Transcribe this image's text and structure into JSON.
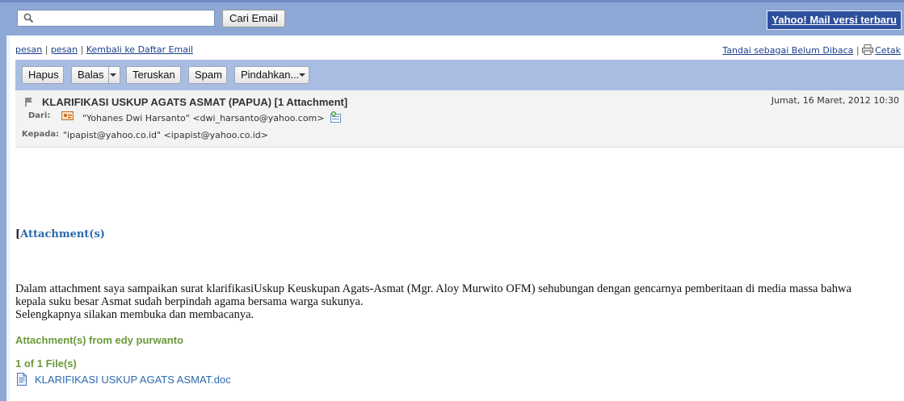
{
  "search": {
    "placeholder": "",
    "button_label": "Cari Email"
  },
  "header_link": {
    "new_mail_label": "Yahoo! Mail versi terbaru"
  },
  "nav": {
    "links": [
      "pesan",
      "pesan",
      "Kembali ke Daftar Email"
    ],
    "separators": [
      "|",
      "|"
    ],
    "mark_unread": "Tandai sebagai Belum Dibaca",
    "right_sep": "|",
    "print": "Cetak"
  },
  "toolbar": {
    "delete": "Hapus",
    "reply": "Balas",
    "forward": "Teruskan",
    "spam": "Spam",
    "move": "Pindahkan..."
  },
  "message": {
    "subject": "KLARIFIKASI USKUP AGATS ASMAT (PAPUA) [1 Attachment]",
    "date": "Jumat, 16 Maret, 2012 10:30",
    "from_label": "Dari:",
    "from_value": "\"Yohanes Dwi Harsanto\" <dwi_harsanto@yahoo.com>",
    "to_label": "Kepada:",
    "to_value": "\"ipapist@yahoo.co.id\" <ipapist@yahoo.co.id>"
  },
  "body": {
    "attachments_bracket": "[",
    "attachments_link": "Attachment(s)",
    "line1": "Dalam attachment saya sampaikan surat klarifikasiUskup Keuskupan Agats-Asmat (Mgr. Aloy Murwito OFM) sehubungan dengan gencarnya pemberitaan di media massa bahwa",
    "line2": "kepala suku besar Asmat sudah berpindah agama bersama warga sukunya.",
    "line3": "Selengkapnya silakan membuka dan membacanya.",
    "attachments_from": "Attachment(s) from edy purwanto",
    "file_count": "1 of 1 File(s)",
    "file_name": "KLARIFIKASI USKUP AGATS ASMAT.doc"
  },
  "icons": [
    "search-icon",
    "print-icon",
    "flag-icon",
    "contact-card-icon",
    "add-contact-icon",
    "doc-file-icon"
  ],
  "colors": {
    "topbar": "#8ea8d6",
    "toolbar": "#a9bde3",
    "new_mail_bg": "#2d4f9c",
    "link": "#1b3f8b",
    "attachment_green": "#6a9a3a"
  }
}
